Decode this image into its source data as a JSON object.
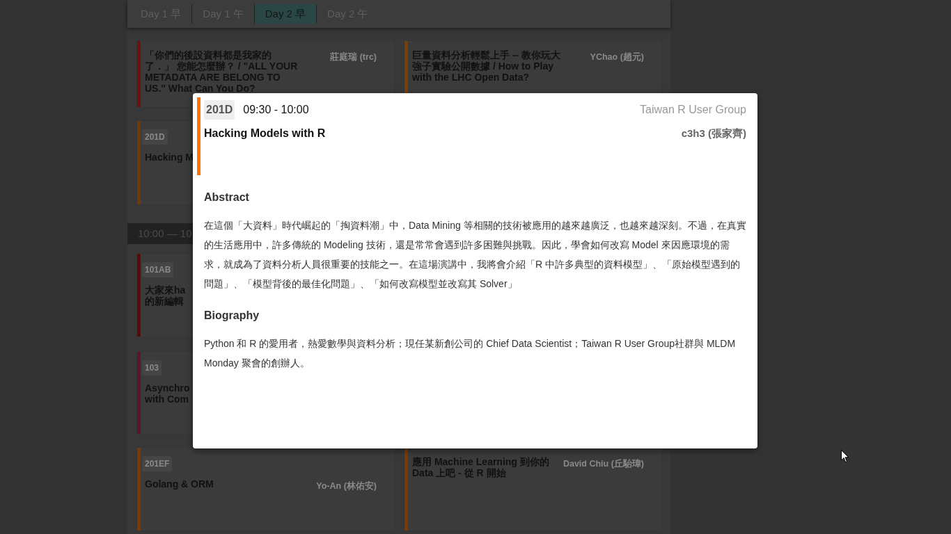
{
  "tabs": [
    {
      "label": "Day 1 早",
      "selected": false
    },
    {
      "label": "Day 1 午",
      "selected": false
    },
    {
      "label": "Day 2 早",
      "selected": true
    },
    {
      "label": "Day 2 午",
      "selected": false
    }
  ],
  "schedule": [
    {
      "kind": "sessions",
      "left": {
        "title": "「你們的後設資料都是我家的了．」 您能怎麼辦？ / \"ALL YOUR METADATA ARE BELONG TO US.\" What Can You Do?",
        "speaker": "莊庭瑞 (trc)",
        "color": "#6b1212"
      },
      "right": {
        "title": "巨量資料分析輕鬆上手 -- 教你玩大強子實驗公開數據 / How to Play with the LHC Open Data?",
        "speaker": "YChao (趙元)",
        "color": "#7a3d0a"
      }
    },
    {
      "kind": "sessions",
      "left": {
        "room": "201D",
        "title": "Hacking M",
        "color": "#6e3a08"
      }
    },
    {
      "kind": "time",
      "label": "10:00 — 10"
    },
    {
      "kind": "sessions",
      "left": {
        "room": "101AB",
        "title": "大家來ha\n的新編輯",
        "color": "#5a0a0a"
      }
    },
    {
      "kind": "sessions",
      "left": {
        "room": "103",
        "title": "Asynchro\nwith Com",
        "color": "#5c1432"
      }
    },
    {
      "kind": "sessions",
      "left": {
        "room": "201EF",
        "title": "Golang & ORM",
        "speaker": "Yo-An (林佑安)",
        "color": "#7a3a08"
      },
      "right": {
        "title": "應用 Machine Learning 到你的 Data 上吧 - 從 R 開始",
        "speaker": "David Chiu (丘駘瑋)",
        "color": "#7a3a08"
      }
    }
  ],
  "modal": {
    "room": "201D",
    "time": "09:30 - 10:00",
    "community": "Taiwan R User Group",
    "title": "Hacking Models with R",
    "speaker": "c3h3 (張家齊)",
    "color": "#ff7300",
    "sections": [
      {
        "heading": "Abstract",
        "text": "在這個「大資料」時代崛起的「掏資料潮」中，Data Mining 等相關的技術被應用的越來越廣泛，也越來越深刻。不過，在真實的生活應用中，許多傳統的 Modeling 技術，還是常常會遇到許多困難與挑戰。因此，學會如何改寫 Model 來因應環境的需求，就成為了資料分析人員很重要的技能之一。在這場演講中，我將會介紹「R 中許多典型的資料模型」、「原始模型遇到的問題」、「模型背後的最佳化問題」、「如何改寫模型並改寫其 Solver」"
      },
      {
        "heading": "Biography",
        "text": "Python 和 R 的愛用者，熱愛數學與資料分析；現任某新創公司的 Chief Data Scientist；Taiwan R User Group社群與 MLDM Monday 聚會的創辦人。"
      }
    ]
  }
}
